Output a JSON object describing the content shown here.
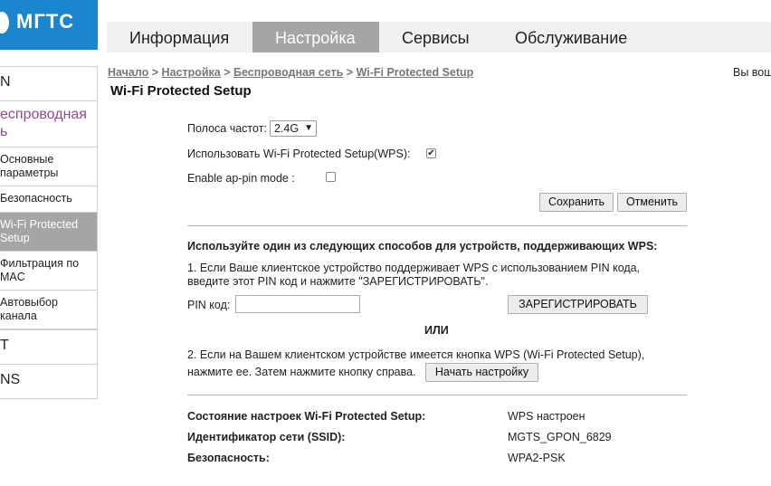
{
  "brand": {
    "logo_text": "МГТС",
    "accent": "#1a86cf"
  },
  "topnav": {
    "tabs": [
      {
        "label": "Информация"
      },
      {
        "label": "Настройка"
      },
      {
        "label": "Сервисы"
      },
      {
        "label": "Обслуживание"
      }
    ],
    "active_tab": "Настройка"
  },
  "sidebar": {
    "item_n": "N",
    "group_label_1": "еспроводная",
    "group_label_2": "ь",
    "sub_basic_1": "Основные",
    "sub_basic_2": "параметры",
    "sub_security": "Безопасность",
    "sub_wps_1": "Wi-Fi Protected",
    "sub_wps_2": "Setup",
    "sub_mac_1": "Фильтрация по",
    "sub_mac_2": "MAC",
    "sub_channel_1": "Автовыбор",
    "sub_channel_2": "канала",
    "item_t": "T",
    "item_ns": "NS"
  },
  "breadcrumb": {
    "home": "Начало",
    "settings": "Настройка",
    "wireless": "Беспроводная сеть",
    "wps": "Wi-Fi Protected Setup",
    "sep": " > "
  },
  "logged_in_text": "Вы вош",
  "page_title": "Wi-Fi Protected Setup",
  "form": {
    "band_label": "Полоса частот:",
    "band_value": "2.4G",
    "use_wps_label": "Использовать Wi-Fi Protected Setup(WPS):",
    "use_wps_checked": true,
    "ap_pin_label": "Enable ap-pin mode :",
    "ap_pin_checked": false,
    "save_label": "Сохранить",
    "cancel_label": "Отменить"
  },
  "methods": {
    "heading": "Используйте один из следующих способов для устройств, поддерживающих WPS:",
    "method1_line1": "1. Если Ваше клиентское устройство поддерживает WPS с использованием PIN кода,",
    "method1_line2": "введите этот PIN код и нажмите \"ЗАРЕГИСТРИРОВАТЬ\".",
    "pin_label": "PIN код:",
    "pin_value": "",
    "register_label": "ЗАРЕГИСТРИРОВАТЬ",
    "or_label": "ИЛИ",
    "method2_line1": "2. Если на Вашем клиентском устройстве имеется кнопка WPS (Wi-Fi Protected Setup),",
    "method2_line2": "нажмите ее. Затем нажмите кнопку справа.",
    "start_label": "Начать настройку"
  },
  "status": {
    "rows": [
      {
        "label": "Состояние настроек Wi-Fi Protected Setup:",
        "value": "WPS настроен"
      },
      {
        "label": "Идентификатор сети (SSID):",
        "value": "MGTS_GPON_6829"
      },
      {
        "label": "Безопасность:",
        "value": "WPA2-PSK"
      }
    ]
  }
}
